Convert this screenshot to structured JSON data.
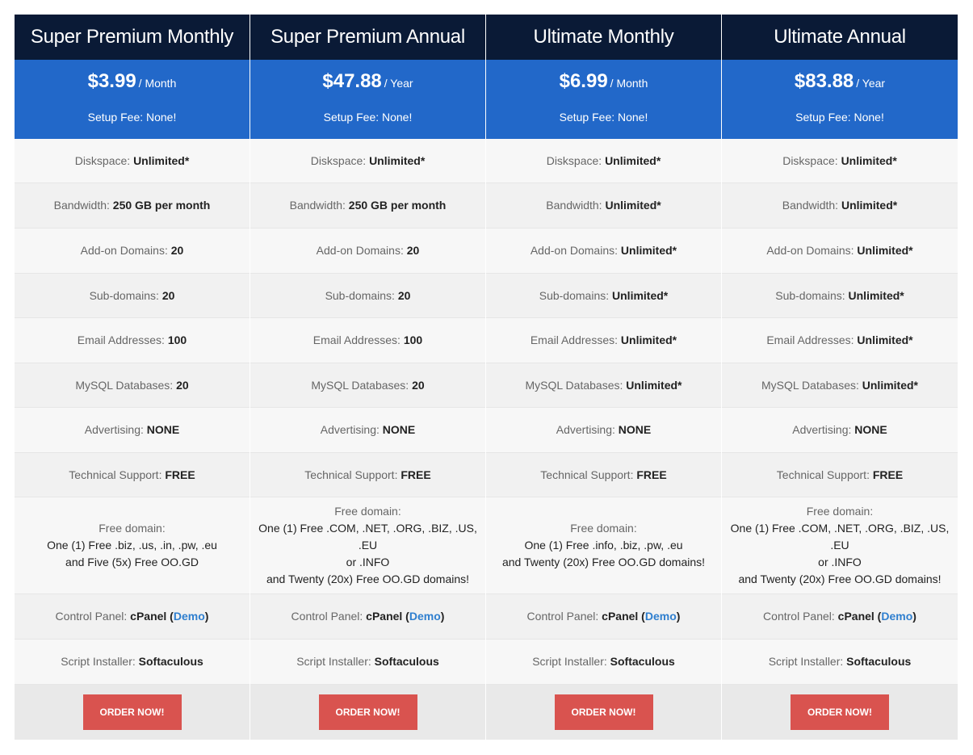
{
  "plans": [
    {
      "name": "Super Premium Monthly",
      "price": "$3.99",
      "period": "/ Month",
      "setup_fee": "Setup Fee: None!",
      "features": [
        {
          "label": "Diskspace:",
          "value": "Unlimited*"
        },
        {
          "label": "Bandwidth:",
          "value": "250 GB per month"
        },
        {
          "label": "Add-on Domains:",
          "value": "20"
        },
        {
          "label": "Sub-domains:",
          "value": "20"
        },
        {
          "label": "Email Addresses:",
          "value": "100"
        },
        {
          "label": "MySQL Databases:",
          "value": "20"
        },
        {
          "label": "Advertising:",
          "value": "NONE"
        },
        {
          "label": "Technical Support:",
          "value": "FREE"
        }
      ],
      "free_domain": {
        "label": "Free domain:",
        "lines": [
          "One (1) Free .biz, .us, .in, .pw, .eu",
          "and Five (5x) Free OO.GD"
        ]
      },
      "control_panel": {
        "label": "Control Panel:",
        "value": "cPanel (",
        "link": "Demo",
        "close": ")"
      },
      "script_installer": {
        "label": "Script Installer:",
        "value": "Softaculous"
      },
      "order_label": "ORDER NOW!"
    },
    {
      "name": "Super Premium Annual",
      "price": "$47.88",
      "period": "/ Year",
      "setup_fee": "Setup Fee: None!",
      "features": [
        {
          "label": "Diskspace:",
          "value": "Unlimited*"
        },
        {
          "label": "Bandwidth:",
          "value": "250 GB per month"
        },
        {
          "label": "Add-on Domains:",
          "value": "20"
        },
        {
          "label": "Sub-domains:",
          "value": "20"
        },
        {
          "label": "Email Addresses:",
          "value": "100"
        },
        {
          "label": "MySQL Databases:",
          "value": "20"
        },
        {
          "label": "Advertising:",
          "value": "NONE"
        },
        {
          "label": "Technical Support:",
          "value": "FREE"
        }
      ],
      "free_domain": {
        "label": "Free domain:",
        "lines": [
          "One (1) Free .COM, .NET, .ORG, .BIZ, .US, .EU",
          "or .INFO",
          "and Twenty (20x) Free OO.GD domains!"
        ]
      },
      "control_panel": {
        "label": "Control Panel:",
        "value": "cPanel (",
        "link": "Demo",
        "close": ")"
      },
      "script_installer": {
        "label": "Script Installer:",
        "value": "Softaculous"
      },
      "order_label": "ORDER NOW!"
    },
    {
      "name": "Ultimate Monthly",
      "price": "$6.99",
      "period": "/ Month",
      "setup_fee": "Setup Fee: None!",
      "features": [
        {
          "label": "Diskspace:",
          "value": "Unlimited*"
        },
        {
          "label": "Bandwidth:",
          "value": "Unlimited*"
        },
        {
          "label": "Add-on Domains:",
          "value": "Unlimited*"
        },
        {
          "label": "Sub-domains:",
          "value": "Unlimited*"
        },
        {
          "label": "Email Addresses:",
          "value": "Unlimited*"
        },
        {
          "label": "MySQL Databases:",
          "value": "Unlimited*"
        },
        {
          "label": "Advertising:",
          "value": "NONE"
        },
        {
          "label": "Technical Support:",
          "value": "FREE"
        }
      ],
      "free_domain": {
        "label": "Free domain:",
        "lines": [
          "One (1) Free .info, .biz, .pw, .eu",
          "and Twenty (20x) Free OO.GD domains!"
        ]
      },
      "control_panel": {
        "label": "Control Panel:",
        "value": "cPanel (",
        "link": "Demo",
        "close": ")"
      },
      "script_installer": {
        "label": "Script Installer:",
        "value": "Softaculous"
      },
      "order_label": "ORDER NOW!"
    },
    {
      "name": "Ultimate Annual",
      "price": "$83.88",
      "period": "/ Year",
      "setup_fee": "Setup Fee: None!",
      "features": [
        {
          "label": "Diskspace:",
          "value": "Unlimited*"
        },
        {
          "label": "Bandwidth:",
          "value": "Unlimited*"
        },
        {
          "label": "Add-on Domains:",
          "value": "Unlimited*"
        },
        {
          "label": "Sub-domains:",
          "value": "Unlimited*"
        },
        {
          "label": "Email Addresses:",
          "value": "Unlimited*"
        },
        {
          "label": "MySQL Databases:",
          "value": "Unlimited*"
        },
        {
          "label": "Advertising:",
          "value": "NONE"
        },
        {
          "label": "Technical Support:",
          "value": "FREE"
        }
      ],
      "free_domain": {
        "label": "Free domain:",
        "lines": [
          "One (1) Free .COM, .NET, .ORG, .BIZ, .US, .EU",
          "or .INFO",
          "and Twenty (20x) Free OO.GD domains!"
        ]
      },
      "control_panel": {
        "label": "Control Panel:",
        "value": "cPanel (",
        "link": "Demo",
        "close": ")"
      },
      "script_installer": {
        "label": "Script Installer:",
        "value": "Softaculous"
      },
      "order_label": "ORDER NOW!"
    }
  ],
  "colors": {
    "header_bg": "#0a1a36",
    "price_bg": "#2268c9",
    "button_bg": "#d9534f",
    "link": "#2f7fcf"
  }
}
